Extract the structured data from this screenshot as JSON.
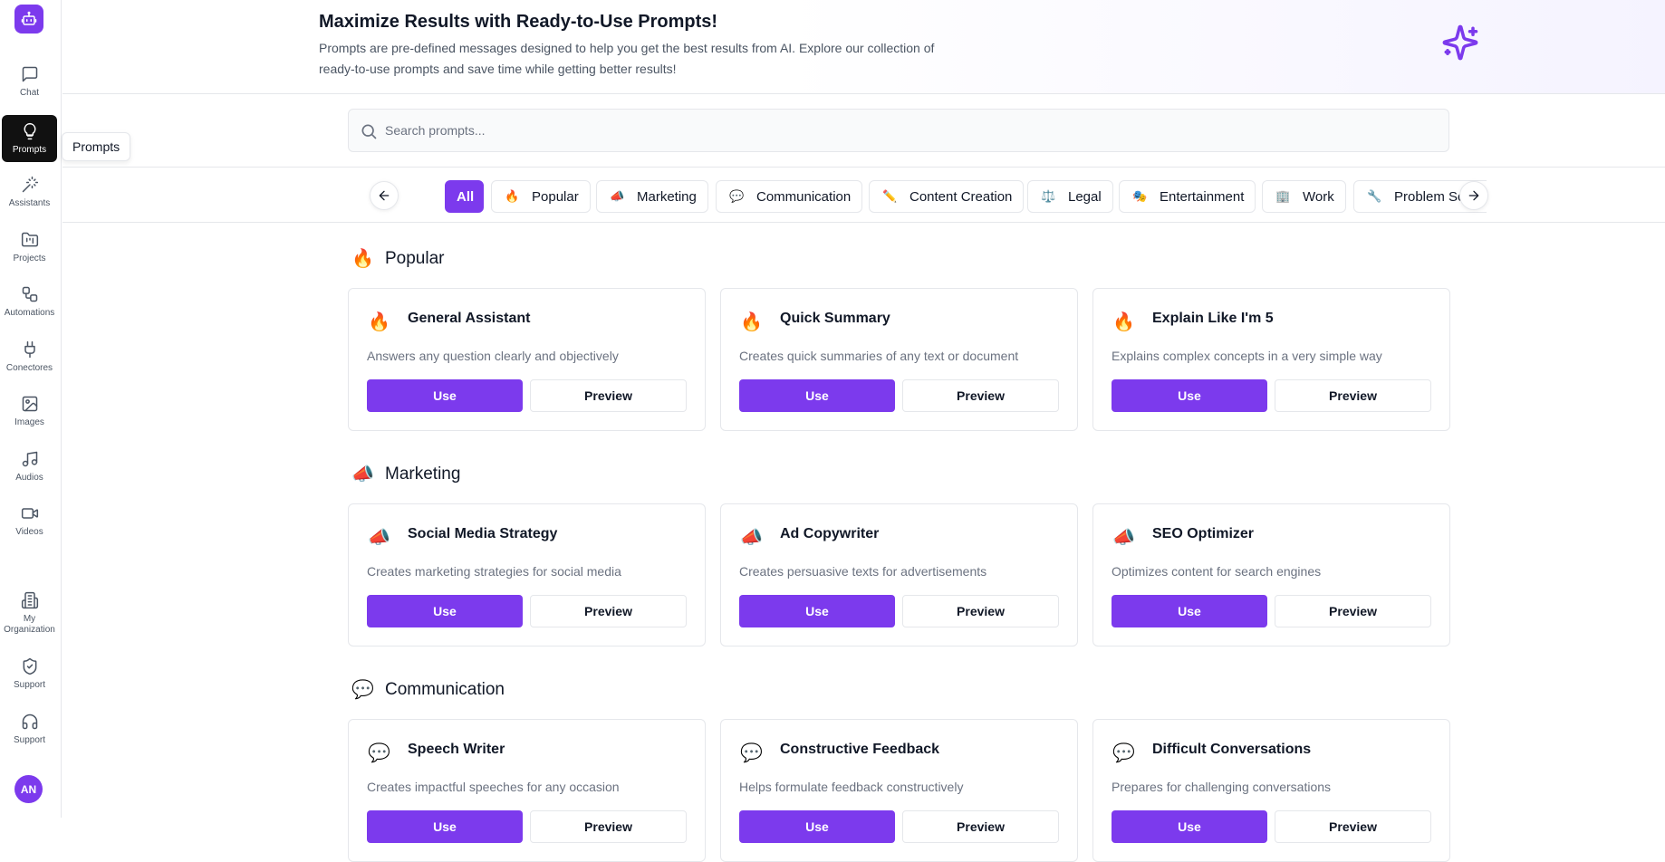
{
  "sidebar": {
    "logo_icon": "robot-icon",
    "items": [
      {
        "label": "Chat",
        "icon": "chat-icon"
      },
      {
        "label": "Prompts",
        "icon": "lightbulb-icon",
        "active": true
      },
      {
        "label": "Assistants",
        "icon": "magic-wand-icon"
      },
      {
        "label": "Projects",
        "icon": "folder-icon"
      },
      {
        "label": "Automations",
        "icon": "workflow-icon"
      },
      {
        "label": "Conectores",
        "icon": "plug-icon"
      },
      {
        "label": "Images",
        "icon": "image-icon"
      },
      {
        "label": "Audios",
        "icon": "music-icon"
      },
      {
        "label": "Videos",
        "icon": "video-icon"
      },
      {
        "label": "My Organization",
        "icon": "building-icon"
      },
      {
        "label": "Support",
        "icon": "shield-icon"
      },
      {
        "label": "Support",
        "icon": "headphones-icon"
      }
    ],
    "avatar_initials": "AN",
    "tooltip": "Prompts"
  },
  "header": {
    "title": "Maximize Results with Ready-to-Use Prompts!",
    "description": "Prompts are pre-defined messages designed to help you get the best results from AI. Explore our collection of ready-to-use prompts and save time while getting better results!"
  },
  "search": {
    "placeholder": "Search prompts..."
  },
  "categories": [
    {
      "label": "All",
      "emoji": "",
      "active": true
    },
    {
      "label": "Popular",
      "emoji": "🔥"
    },
    {
      "label": "Marketing",
      "emoji": "📣"
    },
    {
      "label": "Communication",
      "emoji": "💬"
    },
    {
      "label": "Content Creation",
      "emoji": "✏️"
    },
    {
      "label": "Legal",
      "emoji": "⚖️"
    },
    {
      "label": "Entertainment",
      "emoji": "🎭"
    },
    {
      "label": "Work",
      "emoji": "🏢"
    },
    {
      "label": "Problem Solving",
      "emoji": "🔧"
    }
  ],
  "sections": [
    {
      "title": "Popular",
      "emoji": "🔥",
      "cards": [
        {
          "emoji": "🔥",
          "title": "General Assistant",
          "description": "Answers any question clearly and objectively",
          "use": "Use",
          "preview": "Preview"
        },
        {
          "emoji": "🔥",
          "title": "Quick Summary",
          "description": "Creates quick summaries of any text or document",
          "use": "Use",
          "preview": "Preview"
        },
        {
          "emoji": "🔥",
          "title": "Explain Like I'm 5",
          "description": "Explains complex concepts in a very simple way",
          "use": "Use",
          "preview": "Preview"
        }
      ]
    },
    {
      "title": "Marketing",
      "emoji": "📣",
      "cards": [
        {
          "emoji": "📣",
          "title": "Social Media Strategy",
          "description": "Creates marketing strategies for social media",
          "use": "Use",
          "preview": "Preview"
        },
        {
          "emoji": "📣",
          "title": "Ad Copywriter",
          "description": "Creates persuasive texts for advertisements",
          "use": "Use",
          "preview": "Preview"
        },
        {
          "emoji": "📣",
          "title": "SEO Optimizer",
          "description": "Optimizes content for search engines",
          "use": "Use",
          "preview": "Preview"
        }
      ]
    },
    {
      "title": "Communication",
      "emoji": "💬",
      "cards": [
        {
          "emoji": "💬",
          "title": "Speech Writer",
          "description": "Creates impactful speeches for any occasion",
          "use": "Use",
          "preview": "Preview"
        },
        {
          "emoji": "💬",
          "title": "Constructive Feedback",
          "description": "Helps formulate feedback constructively",
          "use": "Use",
          "preview": "Preview"
        },
        {
          "emoji": "💬",
          "title": "Difficult Conversations",
          "description": "Prepares for challenging conversations",
          "use": "Use",
          "preview": "Preview"
        }
      ]
    }
  ],
  "colors": {
    "accent": "#7c3aed",
    "active_nav": "#111111",
    "border": "#e5e7eb"
  }
}
